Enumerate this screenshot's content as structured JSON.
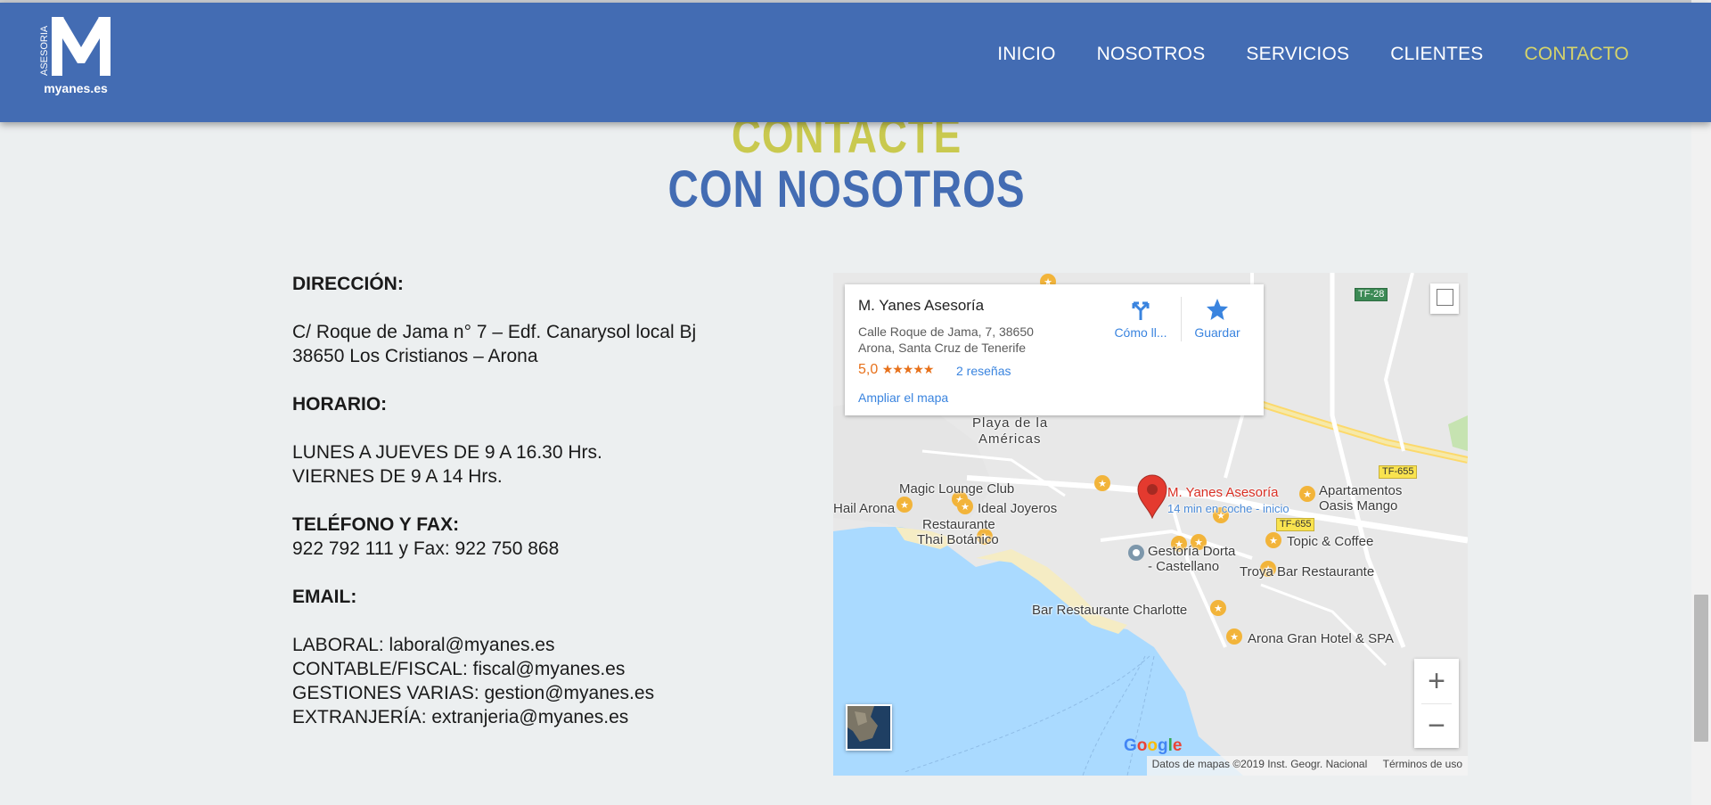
{
  "brand": {
    "logo_side_text": "ASESORIA",
    "logo_name": "myanes.es",
    "primary_color": "#436cb3",
    "accent_color": "#c9c94f"
  },
  "nav": {
    "items": [
      {
        "label": "INICIO",
        "active": false
      },
      {
        "label": "NOSOTROS",
        "active": false
      },
      {
        "label": "SERVICIOS",
        "active": false
      },
      {
        "label": "CLIENTES",
        "active": false
      },
      {
        "label": "CONTACTO",
        "active": true
      }
    ]
  },
  "headings": {
    "line1": "CONTACTE",
    "line2": "CON NOSOTROS"
  },
  "contact": {
    "address_label": "DIRECCIÓN:",
    "address_line1": "C/ Roque de Jama n° 7 – Edf. Canarysol local Bj",
    "address_line2": "38650 Los Cristianos – Arona",
    "hours_label": "HORARIO:",
    "hours_line1": "LUNES A JUEVES DE 9 A 16.30 Hrs.",
    "hours_line2": "VIERNES DE 9 A 14 Hrs.",
    "phone_label": "TELÉFONO Y FAX:",
    "phone_value": "922 792 111 y Fax: 922 750 868",
    "email_label": "EMAIL:",
    "emails": [
      "LABORAL: laboral@myanes.es",
      "CONTABLE/FISCAL: fiscal@myanes.es",
      "GESTIONES VARIAS: gestion@myanes.es",
      "EXTRANJERÍA: extranjeria@myanes.es"
    ]
  },
  "map": {
    "place_name": "M. Yanes Asesoría",
    "address_line1": "Calle Roque de Jama, 7, 38650",
    "address_line2": "Arona, Santa Cruz de Tenerife",
    "rating": "5,0",
    "stars": "★★★★★",
    "reviews": "2 reseñas",
    "enlarge": "Ampliar el mapa",
    "directions": "Cómo ll...",
    "save": "Guardar",
    "zoom_in": "+",
    "zoom_out": "−",
    "google": [
      "G",
      "o",
      "o",
      "g",
      "l",
      "e"
    ],
    "attribution": "Datos de mapas ©2019 Inst. Geogr. Nacional",
    "terms": "Términos de uso",
    "marker_label": "M. Yanes Asesoría",
    "marker_sublabel": "14 min en coche - inicio",
    "labels": {
      "playa": "Playa de la",
      "americas": "Américas",
      "magic": "Magic Lounge Club",
      "ideal": "Ideal Joyeros",
      "rest1": "Restaurante",
      "rest2": "Thai Botánico",
      "hail": "Hail Arona",
      "apart1": "Apartamentos",
      "apart2": "Oasis Mango",
      "topic": "Topic & Coffee",
      "gest1": "Gestoría Dorta",
      "gest2": "- Castellano",
      "troya": "Troya Bar Restaurante",
      "charlotte": "Bar Restaurante Charlotte",
      "arona_hotel": "Arona Gran Hotel & SPA"
    },
    "shields": {
      "tf28": "TF-28",
      "tf655a": "TF-655",
      "tf655b": "TF-655"
    }
  }
}
